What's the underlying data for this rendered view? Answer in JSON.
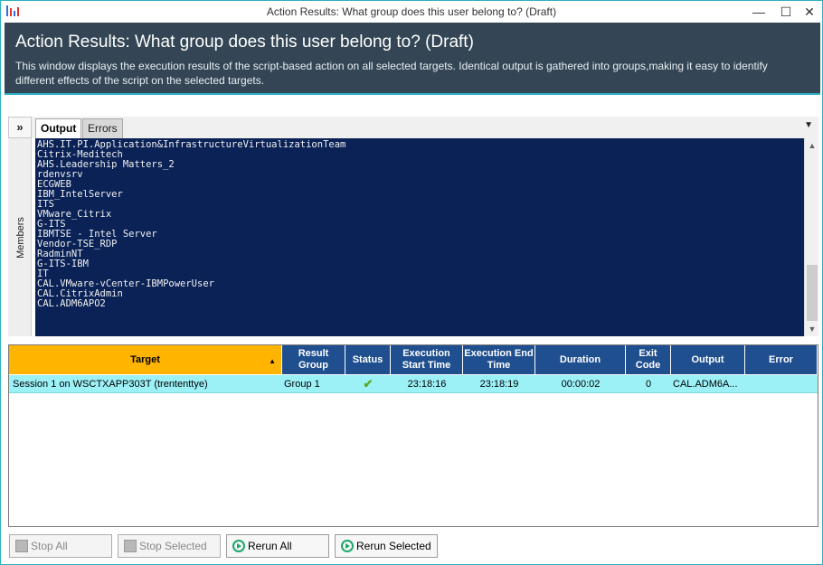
{
  "window": {
    "title": "Action Results: What group does this user belong to? (Draft)",
    "controls": {
      "minimize": "—",
      "maximize": "☐",
      "close": "✕"
    }
  },
  "header": {
    "title": "Action Results: What group does this user belong to? (Draft)",
    "description": "This window displays the execution results of the script-based action on all selected targets. Identical output is gathered into groups,making it easy to identify different effects of the script on the selected targets."
  },
  "side_panel": {
    "expand": "»",
    "label": "Members"
  },
  "tabs": [
    {
      "label": "Output",
      "active": true
    },
    {
      "label": "Errors",
      "active": false
    }
  ],
  "tab_menu_icon": "▼",
  "console_lines": [
    "AHS.IT.PI.Application&InfrastructureVirtualizationTeam",
    "Citrix-Meditech",
    "AHS.Leadership Matters_2",
    "rdenvsrv",
    "ECGWEB",
    "IBM_IntelServer",
    "ITS",
    "VMware_Citrix",
    "G-ITS",
    "IBMTSE - Intel Server",
    "Vendor-TSE_RDP",
    "RadminNT",
    "G-ITS-IBM",
    "IT",
    "CAL.VMware-vCenter-IBMPowerUser",
    "CAL.CitrixAdmin",
    "CAL.ADM6APO2"
  ],
  "scrollbar": {
    "up": "▲",
    "down": "▼"
  },
  "grid": {
    "columns": [
      "Target",
      "Result Group",
      "Status",
      "Execution Start Time",
      "Execution End Time",
      "Duration",
      "Exit Code",
      "Output",
      "Error"
    ],
    "sort_indicator": "▲",
    "rows": [
      {
        "target": "Session 1 on WSCTXAPP303T (trententtye)",
        "result_group": "Group 1",
        "status": "✔",
        "start_time": "23:18:16",
        "end_time": "23:18:19",
        "duration": "00:00:02",
        "exit_code": "0",
        "output": "CAL.ADM6A...",
        "error": ""
      }
    ]
  },
  "buttons": {
    "stop_all": "Stop All",
    "stop_selected": "Stop Selected",
    "rerun_all": "Rerun All",
    "rerun_selected": "Rerun Selected"
  },
  "colors": {
    "header_bg": "#344655",
    "accent": "#2ab0c4",
    "console_bg": "#0a2256",
    "grid_header": "#1f4f8f",
    "sorted_header": "#ffb400",
    "row_highlight": "#9cf1f7",
    "success": "#5aa81e"
  }
}
